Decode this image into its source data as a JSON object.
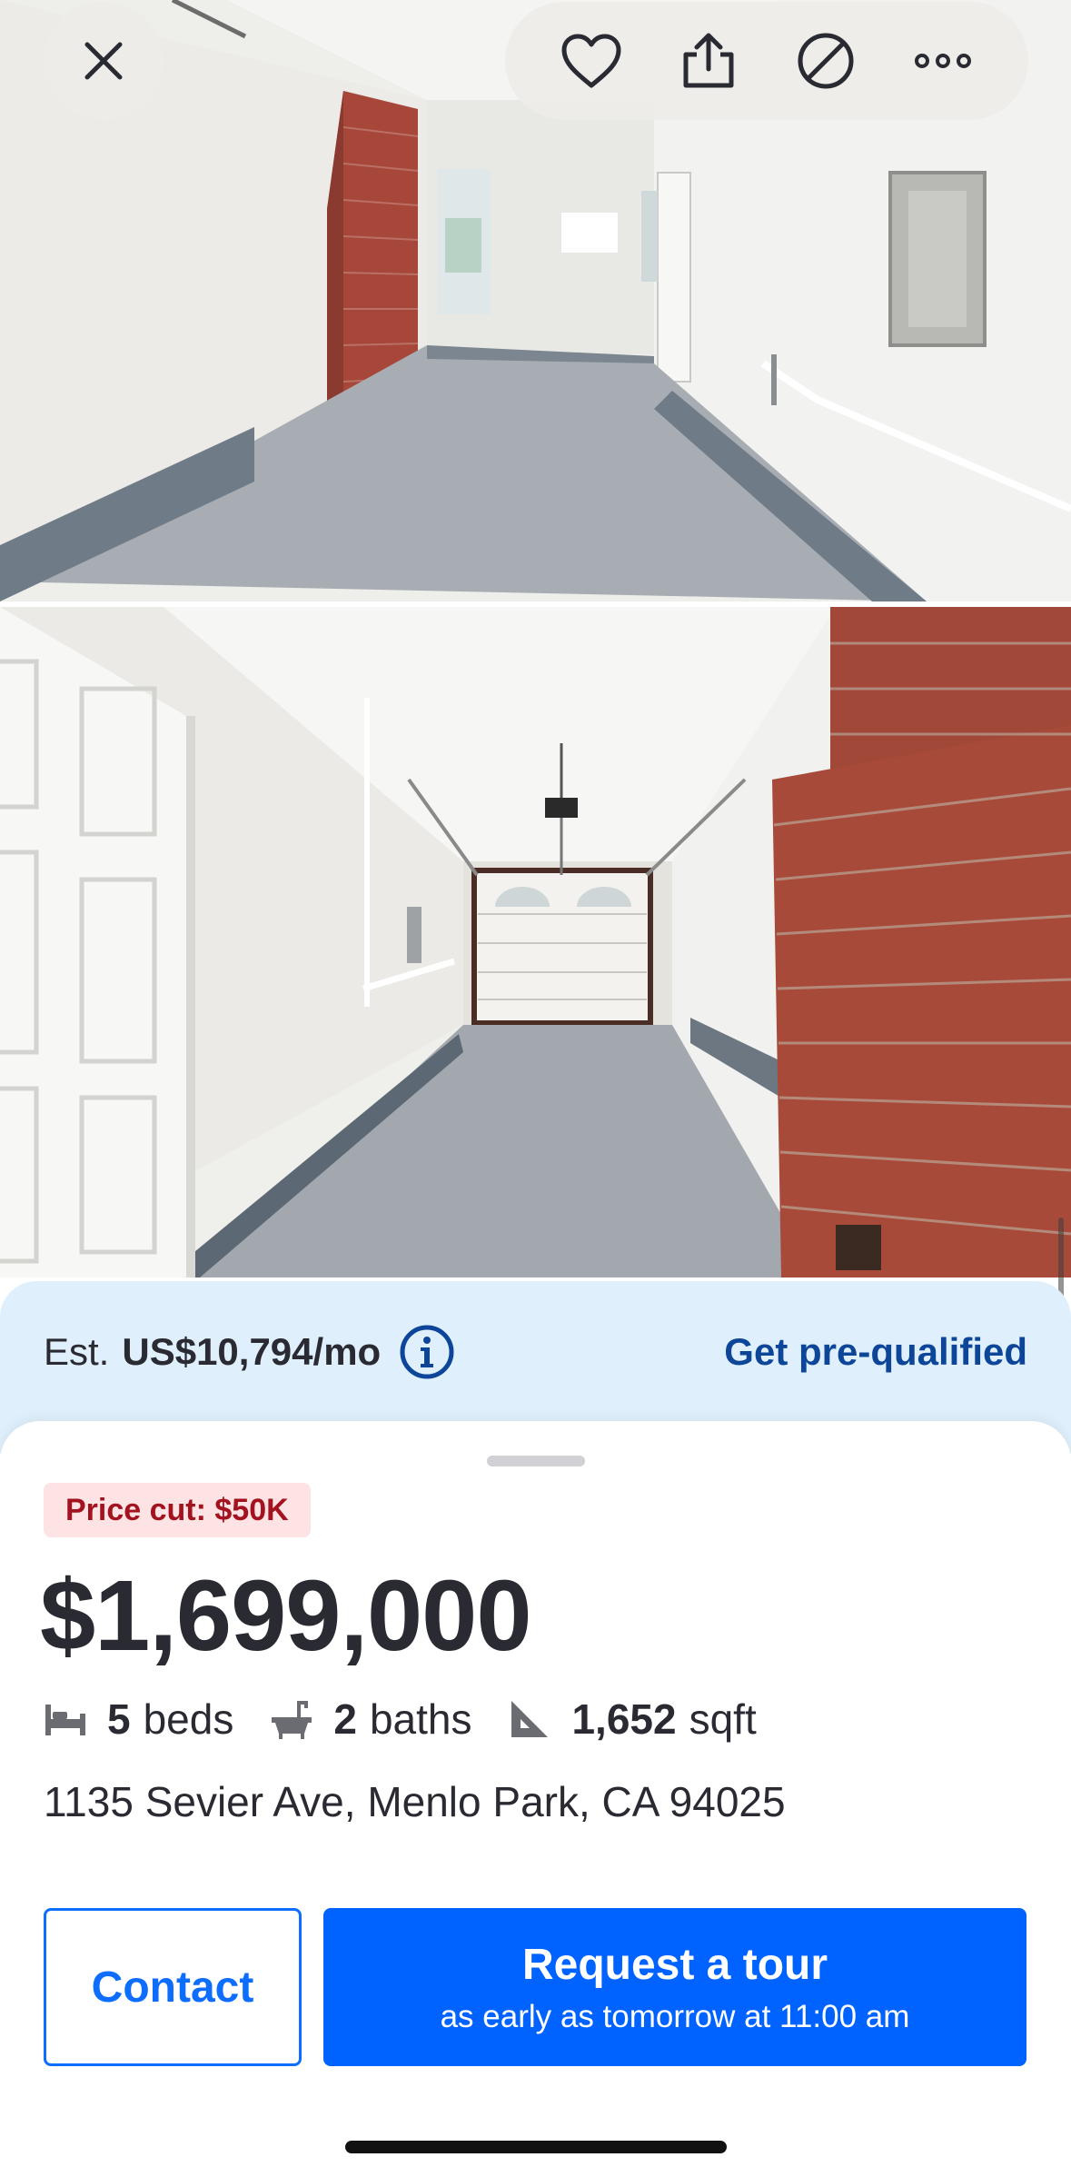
{
  "photos": [
    {
      "alt_name": "garage-interior-photo-1"
    },
    {
      "alt_name": "garage-interior-photo-2"
    }
  ],
  "toolbar": {
    "icons": [
      "close-icon",
      "heart-icon",
      "share-icon",
      "hide-icon",
      "more-icon"
    ]
  },
  "mortgage": {
    "prefix": "Est.",
    "amount": "US$10,794/mo",
    "prequal_label": "Get pre-qualified"
  },
  "listing": {
    "badge": "Price cut: $50K",
    "price": "$1,699,000",
    "beds_value": "5",
    "beds_label": "beds",
    "baths_value": "2",
    "baths_label": "baths",
    "sqft_value": "1,652",
    "sqft_label": "sqft",
    "address": "1135 Sevier Ave, Menlo Park, CA 94025"
  },
  "actions": {
    "contact_label": "Contact",
    "tour_label": "Request a tour",
    "tour_sub": "as early as tomorrow at 11:00 am"
  },
  "colors": {
    "primary": "#0062ff",
    "link": "#0d4599",
    "badge_bg": "#fde3e3",
    "badge_text": "#a3121f",
    "mortgage_bg": "#dff0fc"
  }
}
